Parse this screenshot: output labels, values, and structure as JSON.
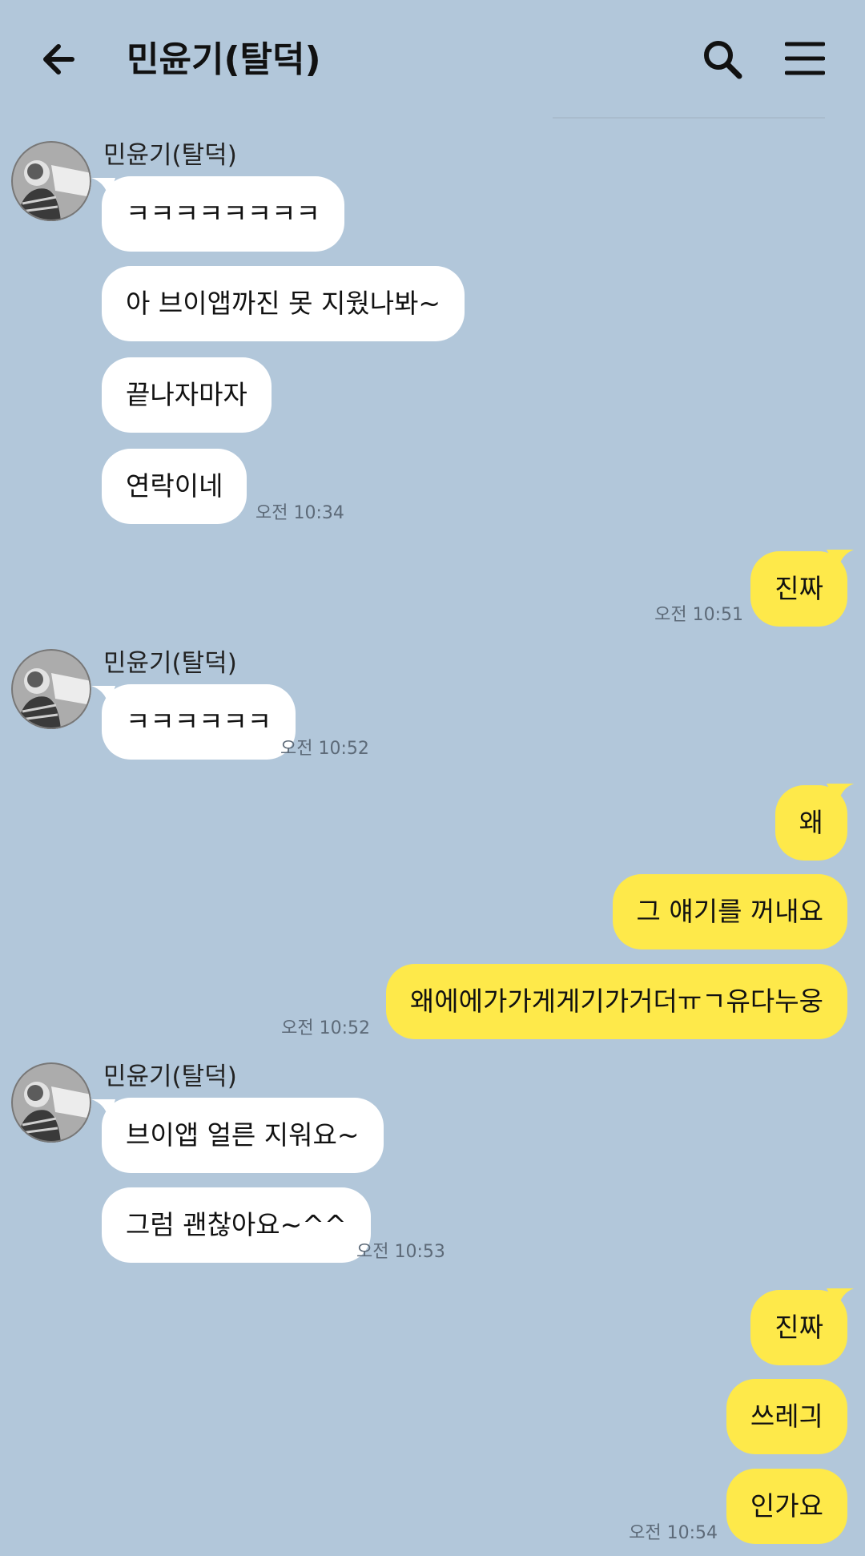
{
  "header": {
    "title": "민윤기(탈덕)",
    "back_icon": "arrow-left-icon",
    "search_icon": "search-icon",
    "menu_icon": "hamburger-menu-icon"
  },
  "messages": [
    {
      "side": "in",
      "sender": "민윤기(탈덕)",
      "texts": [
        "ㅋㅋㅋㅋㅋㅋㅋㅋ",
        "아 브이앱까진 못 지웠나봐~",
        "끝나자마자",
        "연락이네"
      ],
      "time": "오전 10:34"
    },
    {
      "side": "out",
      "texts": [
        "진짜"
      ],
      "time": "오전 10:51"
    },
    {
      "side": "in",
      "sender": "민윤기(탈덕)",
      "texts": [
        "ㅋㅋㅋㅋㅋㅋ"
      ],
      "time": "오전 10:52"
    },
    {
      "side": "out",
      "texts": [
        "왜",
        "그 얘기를 꺼내요",
        "왜에에가가게게기가거더ㅠㄱ유다누웅"
      ],
      "time": "오전 10:52"
    },
    {
      "side": "in",
      "sender": "민윤기(탈덕)",
      "texts": [
        "브이앱 얼른 지워요~",
        "그럼 괜찮아요~^^"
      ],
      "time": "오전 10:53"
    },
    {
      "side": "out",
      "texts": [
        "진짜",
        "쓰레긔",
        "인가요"
      ],
      "time": "오전 10:54"
    }
  ],
  "colors": {
    "background": "#b2c7da",
    "incoming_bubble": "#ffffff",
    "outgoing_bubble": "#fee94a",
    "timestamp": "#5d6a78"
  }
}
